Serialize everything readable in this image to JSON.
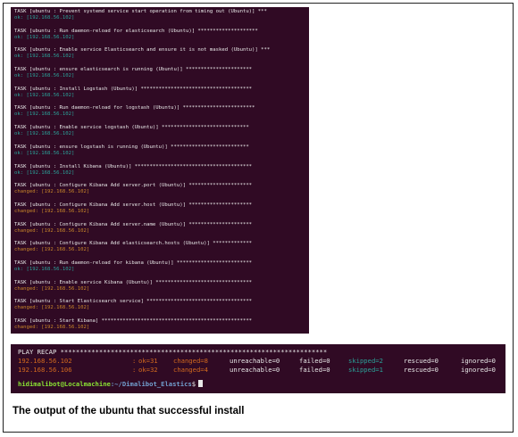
{
  "terminal_log": {
    "tasks": [
      {
        "task": "TASK [ubuntu : Prevent systemd service start operation from timing out (Ubuntu)] ***",
        "status": "ok",
        "result": "ok: [192.168.56.102]"
      },
      {
        "task": "TASK [ubuntu : Run daemon-reload for elasticsearch (Ubuntu)] ********************",
        "status": "ok",
        "result": "ok: [192.168.56.102]"
      },
      {
        "task": "TASK [ubuntu : Enable service Elasticsearch and ensure it is not masked (Ubuntu)] ***",
        "status": "ok",
        "result": "ok: [192.168.56.102]"
      },
      {
        "task": "TASK [ubuntu : ensure elasticsearch is running (Ubuntu)] **********************",
        "status": "ok",
        "result": "ok: [192.168.56.102]"
      },
      {
        "task": "TASK [ubuntu : Install Logstash (Ubuntu)] *************************************",
        "status": "ok",
        "result": "ok: [192.168.56.102]"
      },
      {
        "task": "TASK [ubuntu : Run daemon-reload for logstash (Ubuntu)] ************************",
        "status": "ok",
        "result": "ok: [192.168.56.102]"
      },
      {
        "task": "TASK [ubuntu : Enable service logstash (Ubuntu)] *****************************",
        "status": "ok",
        "result": "ok: [192.168.56.102]"
      },
      {
        "task": "TASK [ubuntu : ensure logstash is running (Ubuntu)] **************************",
        "status": "ok",
        "result": "ok: [192.168.56.102]"
      },
      {
        "task": "TASK [ubuntu : Install Kibana (Ubuntu)] ***************************************",
        "status": "ok",
        "result": "ok: [192.168.56.102]"
      },
      {
        "task": "TASK [ubuntu : Configure Kibana Add server.port (Ubuntu)] *********************",
        "status": "changed",
        "result": "changed: [192.168.56.102]"
      },
      {
        "task": "TASK [ubuntu : Configure Kibana Add server.host (Ubuntu)] *********************",
        "status": "changed",
        "result": "changed: [192.168.56.102]"
      },
      {
        "task": "TASK [ubuntu : Configure Kibana Add server.name (Ubuntu)] *********************",
        "status": "changed",
        "result": "changed: [192.168.56.102]"
      },
      {
        "task": "TASK [ubuntu : Configure Kibana Add elasticsearch.hosts (Ubuntu)] *************",
        "status": "changed",
        "result": "changed: [192.168.56.102]"
      },
      {
        "task": "TASK [ubuntu : Run daemon-reload for kibana (Ubuntu)] *************************",
        "status": "ok",
        "result": "ok: [192.168.56.102]"
      },
      {
        "task": "TASK [ubuntu : Enable service Kibana (Ubuntu)] ********************************",
        "status": "changed",
        "result": "changed: [192.168.56.102]"
      },
      {
        "task": "TASK [ubuntu : Start Elasticsearch service] ***********************************",
        "status": "changed",
        "result": "changed: [192.168.56.102]"
      },
      {
        "task": "TASK [ubuntu : Start Kibana] **************************************************",
        "status": "changed",
        "result": "changed: [192.168.56.102]"
      }
    ]
  },
  "recap": {
    "title": "PLAY RECAP *********************************************************************",
    "rows": [
      {
        "host": "192.168.56.102",
        "colon": ":",
        "ok": "ok=31",
        "changed": "changed=8",
        "unreachable": "unreachable=0",
        "failed": "failed=0",
        "skipped": "skipped=2",
        "rescued": "rescued=0",
        "ignored": "ignored=0"
      },
      {
        "host": "192.168.56.106",
        "colon": ":",
        "ok": "ok=32",
        "changed": "changed=4",
        "unreachable": "unreachable=0",
        "failed": "failed=0",
        "skipped": "skipped=1",
        "rescued": "rescued=0",
        "ignored": "ignored=0"
      }
    ],
    "prompt_user": "hidimalibot@Localmachine",
    "prompt_path": ":~/Dimalibot_Elastics",
    "prompt_symbol": "$"
  },
  "caption": "The output of the ubuntu that successful install",
  "colors": {
    "terminal_bg": "#300a24",
    "ok": "#2aa198",
    "changed": "#c8862a",
    "prompt_user": "#8ae234",
    "prompt_path": "#729fcf"
  }
}
